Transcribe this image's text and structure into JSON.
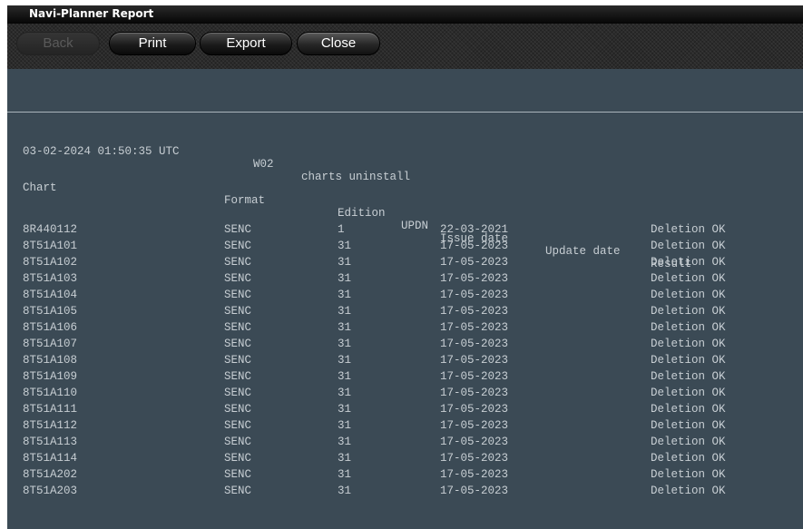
{
  "window": {
    "title": "Navi-Planner Report"
  },
  "toolbar": {
    "back": "Back",
    "print": "Print",
    "export": "Export",
    "close": "Close"
  },
  "report": {
    "session": {
      "timestamp": "03-02-2024 01:50:35 UTC",
      "workstation": "W02",
      "action": "charts uninstall"
    },
    "headers": {
      "chart": "Chart",
      "format": "Format",
      "edition": "Edition",
      "updn": "UPDN",
      "issue_date": "Issue date",
      "update_date": "Update date",
      "result": "Result"
    },
    "rows": [
      {
        "chart": "8R440112",
        "format": "SENC",
        "edition": "1",
        "issue_date": "22-03-2021",
        "result": "Deletion OK"
      },
      {
        "chart": "8T51A101",
        "format": "SENC",
        "edition": "31",
        "issue_date": "17-05-2023",
        "result": "Deletion OK"
      },
      {
        "chart": "8T51A102",
        "format": "SENC",
        "edition": "31",
        "issue_date": "17-05-2023",
        "result": "Deletion OK"
      },
      {
        "chart": "8T51A103",
        "format": "SENC",
        "edition": "31",
        "issue_date": "17-05-2023",
        "result": "Deletion OK"
      },
      {
        "chart": "8T51A104",
        "format": "SENC",
        "edition": "31",
        "issue_date": "17-05-2023",
        "result": "Deletion OK"
      },
      {
        "chart": "8T51A105",
        "format": "SENC",
        "edition": "31",
        "issue_date": "17-05-2023",
        "result": "Deletion OK"
      },
      {
        "chart": "8T51A106",
        "format": "SENC",
        "edition": "31",
        "issue_date": "17-05-2023",
        "result": "Deletion OK"
      },
      {
        "chart": "8T51A107",
        "format": "SENC",
        "edition": "31",
        "issue_date": "17-05-2023",
        "result": "Deletion OK"
      },
      {
        "chart": "8T51A108",
        "format": "SENC",
        "edition": "31",
        "issue_date": "17-05-2023",
        "result": "Deletion OK"
      },
      {
        "chart": "8T51A109",
        "format": "SENC",
        "edition": "31",
        "issue_date": "17-05-2023",
        "result": "Deletion OK"
      },
      {
        "chart": "8T51A110",
        "format": "SENC",
        "edition": "31",
        "issue_date": "17-05-2023",
        "result": "Deletion OK"
      },
      {
        "chart": "8T51A111",
        "format": "SENC",
        "edition": "31",
        "issue_date": "17-05-2023",
        "result": "Deletion OK"
      },
      {
        "chart": "8T51A112",
        "format": "SENC",
        "edition": "31",
        "issue_date": "17-05-2023",
        "result": "Deletion OK"
      },
      {
        "chart": "8T51A113",
        "format": "SENC",
        "edition": "31",
        "issue_date": "17-05-2023",
        "result": "Deletion OK"
      },
      {
        "chart": "8T51A114",
        "format": "SENC",
        "edition": "31",
        "issue_date": "17-05-2023",
        "result": "Deletion OK"
      },
      {
        "chart": "8T51A202",
        "format": "SENC",
        "edition": "31",
        "issue_date": "17-05-2023",
        "result": "Deletion OK"
      },
      {
        "chart": "8T51A203",
        "format": "SENC",
        "edition": "31",
        "issue_date": "17-05-2023",
        "result": "Deletion OK"
      }
    ]
  }
}
